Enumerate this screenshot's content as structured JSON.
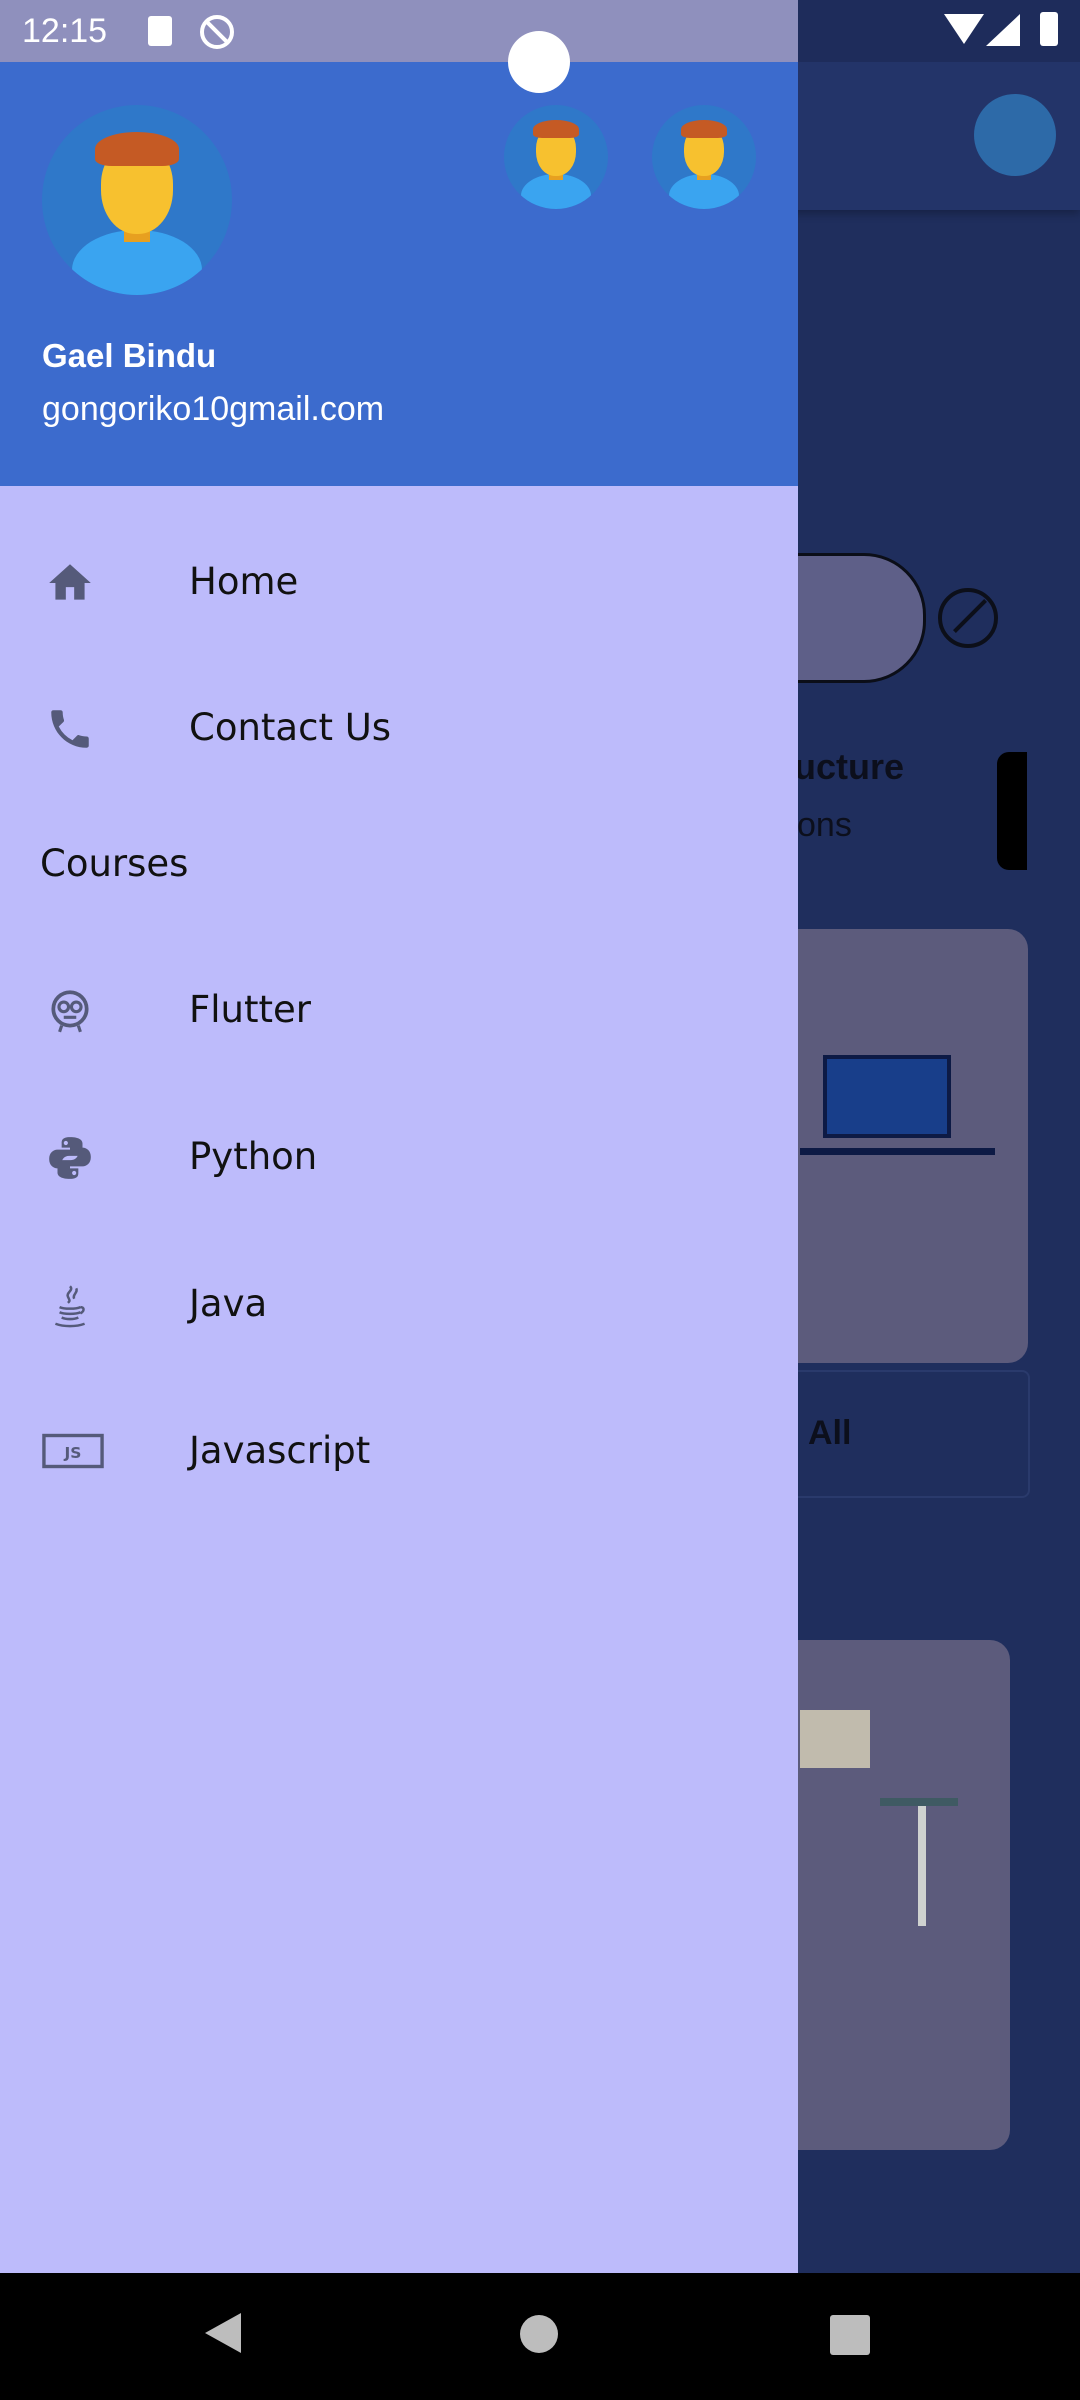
{
  "status_bar": {
    "time": "12:15"
  },
  "drawer": {
    "user": {
      "name": "Gael Bindu",
      "email": "gongoriko10gmail.com"
    },
    "menu": [
      {
        "label": "Home",
        "icon": "home-icon"
      },
      {
        "label": "Contact Us",
        "icon": "phone-icon"
      }
    ],
    "section_title": "Courses",
    "courses": [
      {
        "label": "Flutter",
        "icon": "flutter-icon"
      },
      {
        "label": "Python",
        "icon": "python-icon"
      },
      {
        "label": "Java",
        "icon": "java-icon"
      },
      {
        "label": "Javascript",
        "icon": "javascript-icon"
      }
    ],
    "js_badge": "JS"
  },
  "background": {
    "card_title": "ructure",
    "card_subtitle": "sons",
    "view_all": "All"
  },
  "colors": {
    "drawer_header": "#3c6bcd",
    "drawer_body": "#bdbbfb",
    "icon": "#555a7a",
    "app_background": "#1f2e5d"
  }
}
